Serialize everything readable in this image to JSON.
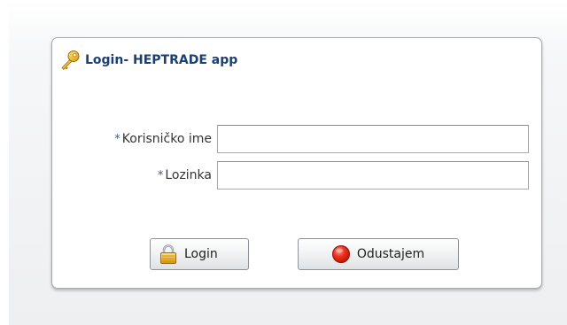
{
  "panel": {
    "title": "Login- HEPTRADE app",
    "icon": "key-icon"
  },
  "form": {
    "username": {
      "required_mark": "*",
      "label": "Korisničko ime",
      "value": ""
    },
    "password": {
      "required_mark": "*",
      "label": "Lozinka",
      "value": ""
    }
  },
  "buttons": {
    "login": {
      "label": "Login",
      "icon": "padlock-icon"
    },
    "cancel": {
      "label": "Odustajem",
      "icon": "red-stop-icon"
    }
  },
  "colors": {
    "title": "#1b3f72",
    "required_star": "#3c5a86",
    "panel_border": "#a8aaad"
  }
}
